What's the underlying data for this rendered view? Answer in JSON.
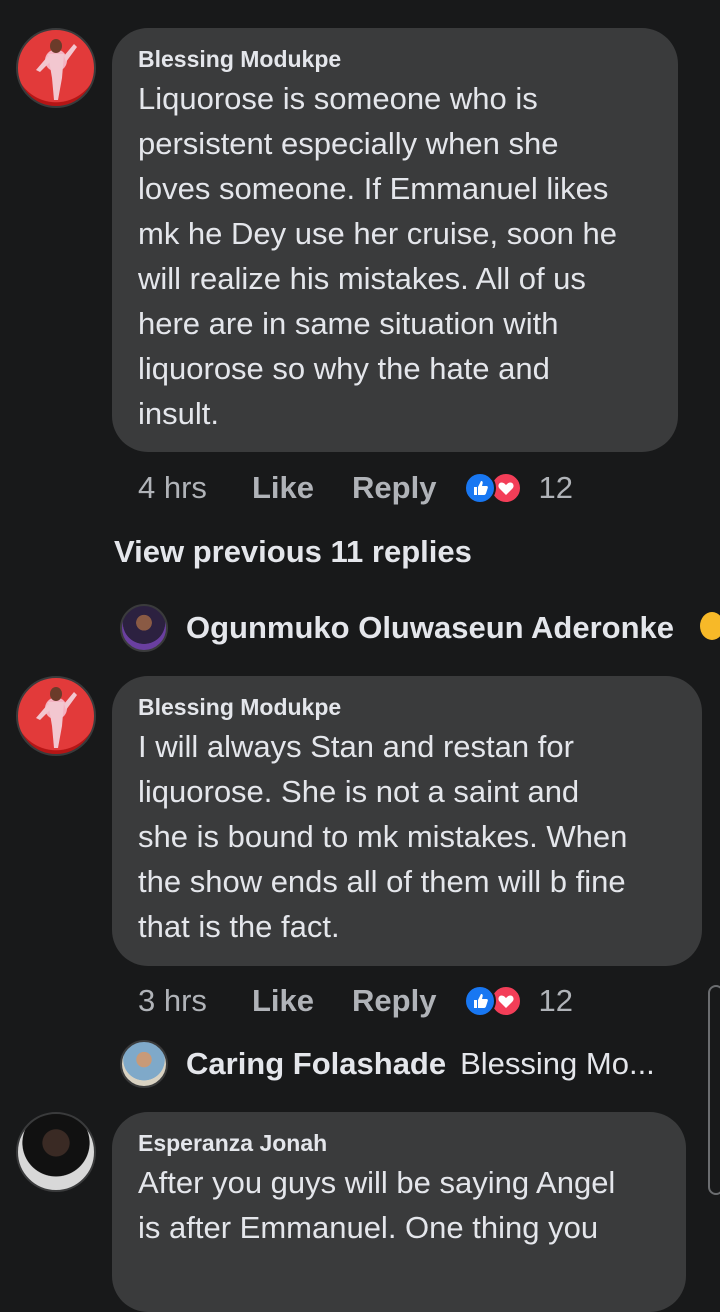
{
  "comments": [
    {
      "author": "Blessing Modukpe",
      "lines": [
        "Liquorose is someone who is",
        "persistent especially when she",
        "loves someone. If Emmanuel likes",
        "mk he Dey use her cruise, soon he",
        "will realize his mistakes. All of us",
        "here are in same situation with",
        "liquorose so why the hate and",
        "insult."
      ],
      "time": "4 hrs",
      "like_label": "Like",
      "reply_label": "Reply",
      "reaction_count": "12"
    },
    {
      "author": "Blessing Modukpe",
      "lines": [
        "I will always Stan and restan for",
        "liquorose. She is not a saint and",
        "she is bound to mk mistakes. When",
        "the show ends all of them will b fine",
        "that is the fact."
      ],
      "time": "3 hrs",
      "like_label": "Like",
      "reply_label": "Reply",
      "reaction_count": "12"
    },
    {
      "author": "Esperanza Jonah",
      "lines": [
        "After you guys will be saying Angel",
        "is after Emmanuel. One thing you"
      ]
    }
  ],
  "view_previous": "View previous 11 replies",
  "reply_previews": [
    {
      "name": "Ogunmuko Oluwaseun Aderonke",
      "snippet": ""
    },
    {
      "name": "Caring Folashade",
      "snippet": "Blessing Mo..."
    }
  ],
  "reactions": [
    "like-icon",
    "love-icon"
  ],
  "colors": {
    "background": "#18191a",
    "bubble": "#3a3b3c",
    "text": "#e4e6eb",
    "secondary_text": "#b0b3b8",
    "like_blue": "#1877f2",
    "love_red": "#f33e58"
  }
}
